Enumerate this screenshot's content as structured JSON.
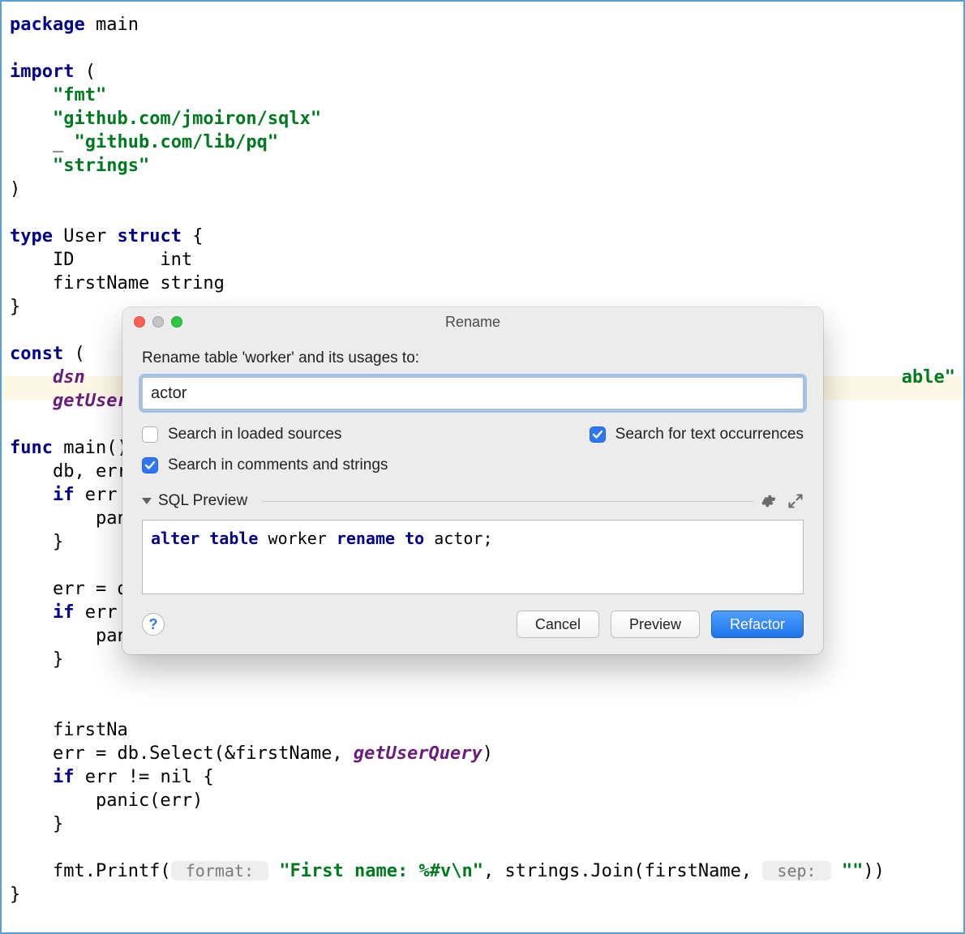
{
  "code": {
    "line1_kw": "package",
    "line1_id": " main",
    "blank": "",
    "import_kw": "import",
    "import_open": " (",
    "imp1": "\"fmt\"",
    "imp2": "\"github.com/jmoiron/sqlx\"",
    "imp3_blank": "_ ",
    "imp3": "\"github.com/lib/pq\"",
    "imp4": "\"strings\"",
    "close_paren": ")",
    "type_kw": "type",
    "type_name": " User ",
    "struct_kw": "struct",
    "struct_open": " {",
    "field1": "    ID        int",
    "field2": "    firstName string",
    "close_brace": "}",
    "const_kw": "const",
    "const_open": " (",
    "dsn_name": "dsn",
    "able_tail": "able\"",
    "getuser_name": "getUser",
    "func_kw": "func",
    "main_sig": " main()",
    "db_line": "    db, err",
    "if_kw": "if",
    "if_tail": " err",
    "pan_head": "        pan",
    "close_b1": "    }",
    "err_line": "    err = d",
    "if2_tail": " err ",
    "firstna": "    firstNa",
    "select_line_a": "    err = db.Select(&firstName, ",
    "getuserq": "getUserQuery",
    "select_line_b": ")",
    "if3": " err != nil {",
    "panic_full": "        panic(err)",
    "printf_a": "    fmt.Printf(",
    "hint_format": " format: ",
    "printf_str": "\"First name: %#v\\n\"",
    "printf_b": ", strings.Join(firstName, ",
    "hint_sep": " sep: ",
    "printf_sep": "\"\"",
    "printf_c": "))"
  },
  "dialog": {
    "title": "Rename",
    "prompt": "Rename table 'worker' and its usages to:",
    "input_value": "actor",
    "ck_loaded": "Search in loaded sources",
    "ck_loaded_checked": false,
    "ck_text": "Search for text occurrences",
    "ck_text_checked": true,
    "ck_comments": "Search in comments and strings",
    "ck_comments_checked": true,
    "section": "SQL Preview",
    "sql": {
      "alter": "alter",
      "table": "table",
      "worker": " worker ",
      "rename": "rename",
      "to": "to",
      "actor": " actor;"
    },
    "help": "?",
    "cancel": "Cancel",
    "preview": "Preview",
    "refactor": "Refactor"
  }
}
